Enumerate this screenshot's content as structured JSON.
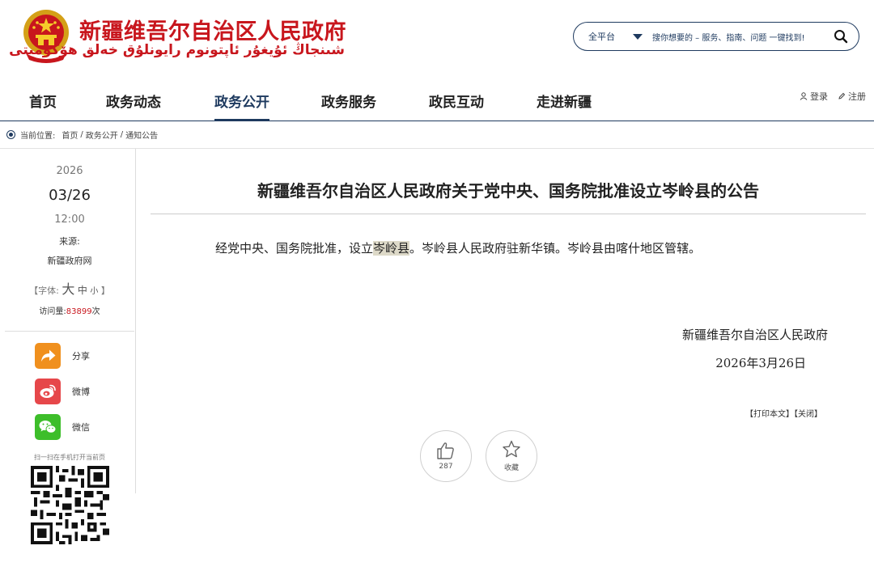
{
  "header": {
    "site_title": "新疆维吾尔自治区人民政府",
    "site_subtitle": "شىنجاڭ ئۇيغۇر ئاپتونوم رايونلۇق خەلق ھۆكۈمىتى",
    "search": {
      "scope": "全平台",
      "placeholder": "搜你想要的 – 服务、指南、问题 一键找到!"
    }
  },
  "nav": {
    "items": [
      "首页",
      "政务动态",
      "政务公开",
      "政务服务",
      "政民互动",
      "走进新疆"
    ],
    "active_index": 2,
    "login": "登录",
    "register": "注册"
  },
  "breadcrumb": {
    "label": "当前位置:",
    "items": [
      "首页",
      "政务公开",
      "通知公告"
    ],
    "separator": "/"
  },
  "sidebar": {
    "year": "2026",
    "month_day": "03/26",
    "time": "12:00",
    "source_label": "来源:",
    "source": "新疆政府网",
    "font_open": "【字体:",
    "font_big": "大",
    "font_mid": "中",
    "font_small": "小",
    "font_close": "】",
    "visits_label": "访问量:",
    "visits_count": "83899",
    "visits_unit": "次",
    "share": [
      {
        "label": "分享",
        "icon": "share-icon",
        "color": "#f0901e"
      },
      {
        "label": "微博",
        "icon": "weibo-icon",
        "color": "#e6474a"
      },
      {
        "label": "微信",
        "icon": "wechat-icon",
        "color": "#3dbe2a"
      }
    ],
    "qr_caption": "扫一扫在手机打开当前页"
  },
  "article": {
    "title": "新疆维吾尔自治区人民政府关于党中央、国务院批准设立岑岭县的公告",
    "body_before": "经党中央、国务院批准，设立",
    "body_highlight": "岑岭县",
    "body_after": "。岑岭县人民政府驻新华镇。岑岭县由喀什地区管辖。",
    "sign_org": "新疆维吾尔自治区人民政府",
    "sign_date": "2026年3月26日",
    "print": "【打印本文】",
    "close": "【关闭】",
    "like_count": "287",
    "favorite_label": "收藏"
  },
  "colors": {
    "brand_red": "#c8161d",
    "nav_blue": "#1e3a5f"
  }
}
